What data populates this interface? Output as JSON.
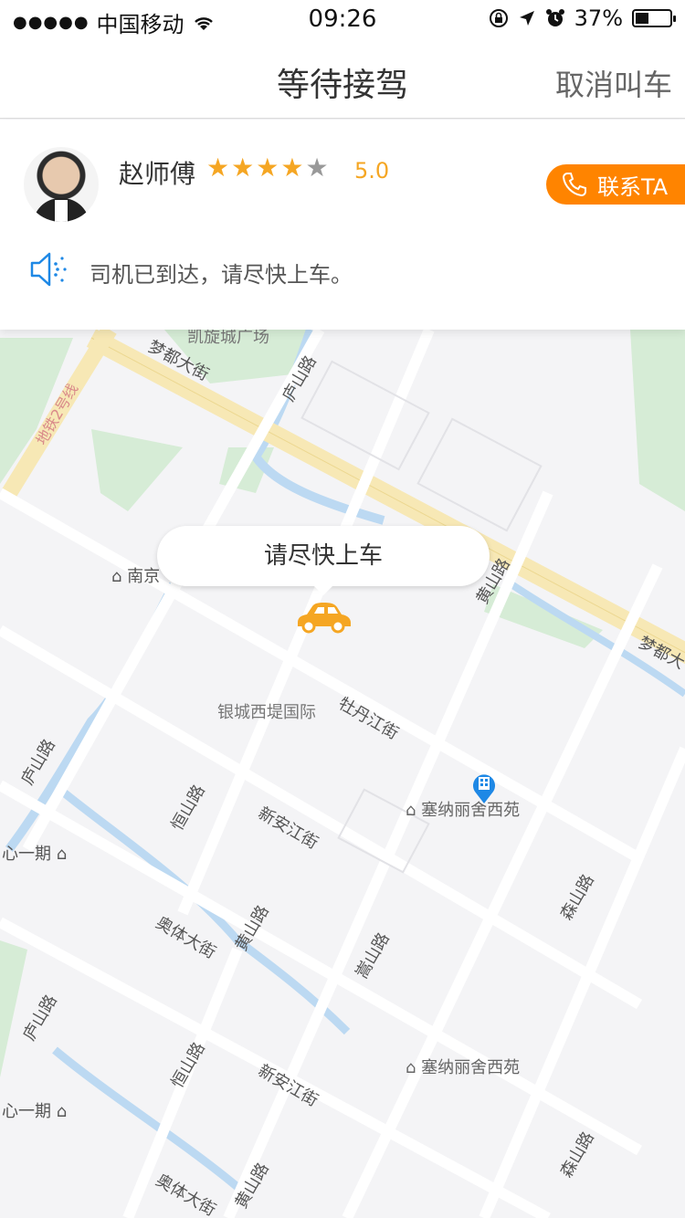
{
  "status_bar": {
    "signal": "●●●●●",
    "carrier": "中国移动",
    "time": "09:26",
    "battery_percent": "37%",
    "battery_level": 0.37
  },
  "nav": {
    "title": "等待接驾",
    "cancel_label": "取消叫车"
  },
  "driver": {
    "name": "赵师傅",
    "stars": [
      "★",
      "★",
      "★",
      "★",
      "★"
    ],
    "rating": "5.0",
    "contact_label": "联系TA",
    "notice": "司机已到达，请尽快上车。"
  },
  "map": {
    "bubble_text": "请尽快上车",
    "labels": {
      "kaixuan_plaza": "凯旋城广场",
      "mengdu_street_1": "梦都大街",
      "mengdu_street_2": "梦都大",
      "lushan_road_1": "庐山路",
      "lushan_road_2": "庐山路",
      "lushan_road_3": "庐山路",
      "metro_line": "地铁2号线",
      "nanjing": "南京",
      "huangshan_road_1": "黄山路",
      "huangshan_road_2": "黄山路",
      "huangshan_road_3": "黄山路",
      "yincheng": "银城西堤国际",
      "mudanjiang_street": "牡丹江街",
      "sainali_1": "塞纳丽舍西苑",
      "sainali_2": "塞纳丽舍西苑",
      "hengshan_road_1": "恒山路",
      "hengshan_road_2": "恒山路",
      "xinanjiang_street_1": "新安江街",
      "xinanjiang_street_2": "新安江街",
      "songshan_road": "嵩山路",
      "sen_road_1": "森山路",
      "sen_road_2": "森山路",
      "aoti_street_1": "奥体大街",
      "aoti_street_2": "奥体大街",
      "xinyiqi_1": "心一期",
      "xinyiqi_2": "心一期"
    }
  },
  "colors": {
    "accent": "#ff8400",
    "star": "#f5a623",
    "road_major": "#f7e8b5",
    "water": "#bcd9f2",
    "green": "#d6ecd6",
    "pin": "#1e88e5"
  },
  "icons": {
    "wifi": "wifi-icon",
    "lock_rotation": "lock-rotation-icon",
    "location": "location-arrow-icon",
    "alarm": "alarm-icon",
    "phone": "phone-icon",
    "speaker": "speaker-icon",
    "car": "car-icon",
    "pin": "building-pin-icon"
  }
}
